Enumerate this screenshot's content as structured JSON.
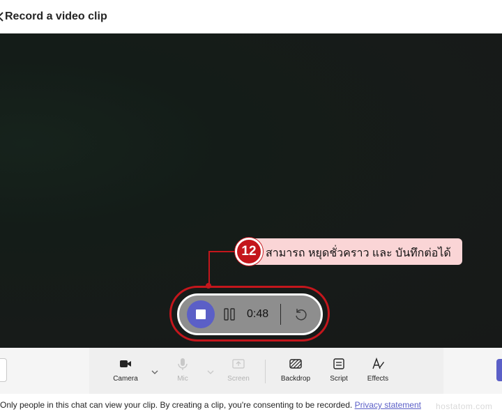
{
  "header": {
    "title": "Record a video clip",
    "back_icon": "chevron-left-icon"
  },
  "recording_controls": {
    "timer": "0:48",
    "stop_icon": "stop-icon",
    "pause_icon": "pause-icon",
    "reset_icon": "retake-icon"
  },
  "callout": {
    "step": "12",
    "text": "สามารถ หยุดชั่วคราว และ บันทึกต่อได้",
    "color": "#c4161c",
    "background": "#fad5d6"
  },
  "toolbar": {
    "camera_label": "Camera",
    "mic_label": "Mic",
    "screen_label": "Screen",
    "backdrop_label": "Backdrop",
    "script_label": "Script",
    "effects_label": "Effects"
  },
  "footer": {
    "consent_text": "Only people in this chat can view your clip. By creating a clip, you're consenting to be recorded.",
    "privacy_link": "Privacy statement"
  },
  "watermark": "hostatom.com",
  "colors": {
    "accent": "#5b5fc7",
    "annotation": "#c4161c"
  }
}
